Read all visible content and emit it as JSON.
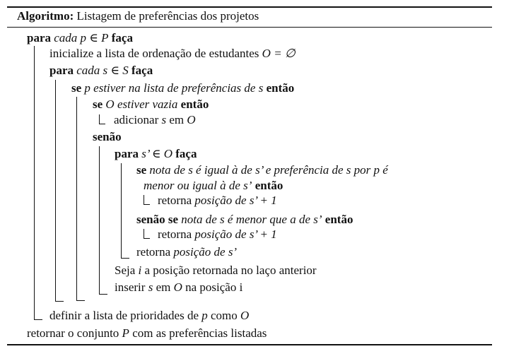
{
  "title": {
    "label": "Algoritmo:",
    "text": "Listagem de preferências dos projetos"
  },
  "lines": {
    "l1": {
      "kw1": "para",
      "t1": "cada",
      "t2": "p ∈ P",
      "kw2": "faça"
    },
    "l2": {
      "t1": "inicialize a lista de ordenação de estudantes",
      "t2": "O = ∅"
    },
    "l3": {
      "kw1": "para",
      "t1": "cada",
      "t2": "s ∈ S",
      "kw2": "faça"
    },
    "l4": {
      "kw1": "se",
      "t1": "p estiver na lista de preferências de s",
      "kw2": "então"
    },
    "l5": {
      "kw1": "se",
      "t1": "O estiver vazia",
      "kw2": "então"
    },
    "l6": {
      "t1": "adicionar",
      "t2": "s",
      "t3": "em",
      "t4": "O"
    },
    "l7": {
      "kw1": "senão"
    },
    "l8": {
      "kw1": "para",
      "t1": "s’ ∈ O",
      "kw2": "faça"
    },
    "l9": {
      "kw1": "se",
      "t1": "nota de s é igual à de s’ e preferência de s por p é"
    },
    "l10": {
      "t1": "menor ou igual à de s’",
      "kw1": "então"
    },
    "l11": {
      "t1": "retorna",
      "t2": "posição de s’ + 1"
    },
    "l12": {
      "kw1": "senão se",
      "t1": "nota de s é menor que a de s’",
      "kw2": "então"
    },
    "l13": {
      "t1": "retorna",
      "t2": "posição de s’ + 1"
    },
    "l14": {
      "t1": "retorna",
      "t2": "posição de s’"
    },
    "l15": {
      "t1": "Seja",
      "t2": "i",
      "t3": "a posição retornada no laço anterior"
    },
    "l16": {
      "t1": "inserir",
      "t2": "s",
      "t3": "em",
      "t4": "O",
      "t5": "na posição i"
    },
    "l17": {
      "t1": "definir a lista de prioridades de",
      "t2": "p",
      "t3": "como",
      "t4": "O"
    },
    "l18": {
      "t1": "retornar o conjunto",
      "t2": "P",
      "t3": "com as preferências listadas"
    }
  }
}
